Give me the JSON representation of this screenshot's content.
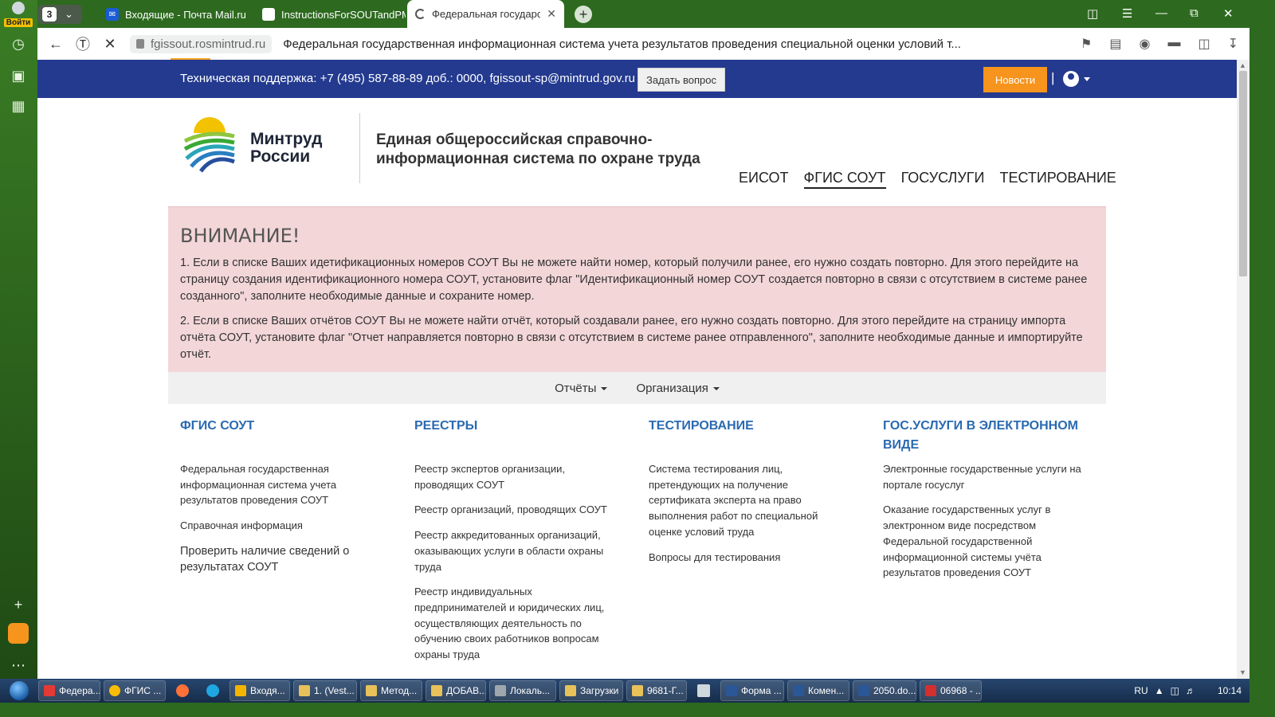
{
  "browser": {
    "login_label": "Войти",
    "tab_count": "3",
    "tabs": [
      {
        "title": "Входящие - Почта Mail.ru",
        "fav_color": "#1a5bd6"
      },
      {
        "title": "InstructionsForSOUTandPMO",
        "fav_color": "#ffffff"
      },
      {
        "title": "Федеральная государстве",
        "fav_color": "#ffffff",
        "active": true
      }
    ],
    "host": "fgissout.rosmintrud.ru",
    "page_title": "Федеральная государственная информационная система учета результатов проведения специальной оценки условий т..."
  },
  "topbar": {
    "support": "Техническая поддержка: +7 (495) 587-88-89 доб.: 0000, fgissout-sp@mintrud.gov.ru",
    "ask_button": "Задать вопрос",
    "news_button": "Новости",
    "separator": "|"
  },
  "header": {
    "logo_line1": "Минтруд",
    "logo_line2": "России",
    "site_title_line1": "Единая общероссийская справочно-",
    "site_title_line2": "информационная система по охране труда",
    "nav": [
      "ЕИСОТ",
      "ФГИС СОУТ",
      "ГОСУСЛУГИ",
      "ТЕСТИРОВАНИЕ"
    ]
  },
  "warning": {
    "title": "ВНИМАНИЕ!",
    "p1": "1. Если в списке Ваших идетификационных номеров СОУТ Вы не можете найти номер, который получили ранее, его нужно создать повторно. Для этого перейдите на страницу создания идентификационного номера СОУТ, установите флаг \"Идентификационный номер СОУТ создается повторно в связи с отсутствием в системе ранее созданного\", заполните необходимые данные и сохраните номер.",
    "p2": "2. Если в списке Ваших отчётов СОУТ Вы не можете найти отчёт, который создавали ранее, его нужно создать повторно. Для этого перейдите на страницу импорта отчёта СОУТ, установите флаг \"Отчет направляется повторно в связи с отсутствием в системе ранее отправленного\", заполните необходимые данные и импортируйте отчёт."
  },
  "subnav": {
    "reports": "Отчёты",
    "org": "Организация"
  },
  "columns": {
    "c1": {
      "title": "ФГИС СОУТ",
      "l1": "Федеральная государственная информационная система учета результатов проведения СОУТ",
      "l2": "Справочная информация",
      "l3": "Проверить наличие сведений о результатах СОУТ"
    },
    "c2": {
      "title": "РЕЕСТРЫ",
      "l1": "Реестр экспертов организации, проводящих СОУТ",
      "l2": "Реестр организаций, проводящих СОУТ",
      "l3": "Реестр аккредитованных организаций, оказывающих услуги в области охраны труда",
      "l4": "Реестр индивидуальных предпринимателей и юридических лиц, осуществляющих деятельность по обучению своих работников вопросам охраны труда"
    },
    "c3": {
      "title": "ТЕСТИРОВАНИЕ",
      "l1": "Система тестирования лиц, претендующих на получение сертификата эксперта на право выполнения работ по специальной оценке условий труда",
      "l2": "Вопросы для тестирования"
    },
    "c4": {
      "title": "ГОС.УСЛУГИ В ЭЛЕКТРОННОМ ВИДЕ",
      "l1": "Электронные государственные услуги на портале госуслуг",
      "l2": "Оказание государственных услуг в электронном виде посредством Федеральной государственной информационной системы учёта результатов проведения СОУТ"
    }
  },
  "taskbar": {
    "items": [
      {
        "label": "Федера...",
        "color": "#e53935"
      },
      {
        "label": "ФГИС ...",
        "color": "#fbbc05"
      },
      {
        "label": "Входя...",
        "color": "#f5b400"
      },
      {
        "label": "1. (Vest...",
        "color": "#e8c15a"
      },
      {
        "label": "Метод...",
        "color": "#e8c15a"
      },
      {
        "label": "ДОБАВ...",
        "color": "#e8c15a"
      },
      {
        "label": "Локаль...",
        "color": "#9ea7ad"
      },
      {
        "label": "Загрузки",
        "color": "#e8c15a"
      },
      {
        "label": "9681-Г...",
        "color": "#e8c15a"
      },
      {
        "label": "Форма ...",
        "color": "#2b5797"
      },
      {
        "label": "Комен...",
        "color": "#2b5797"
      },
      {
        "label": "2050.do...",
        "color": "#2b5797"
      },
      {
        "label": "06968 - ...",
        "color": "#d32f2f"
      }
    ],
    "lang": "RU",
    "clock": "10:14"
  }
}
